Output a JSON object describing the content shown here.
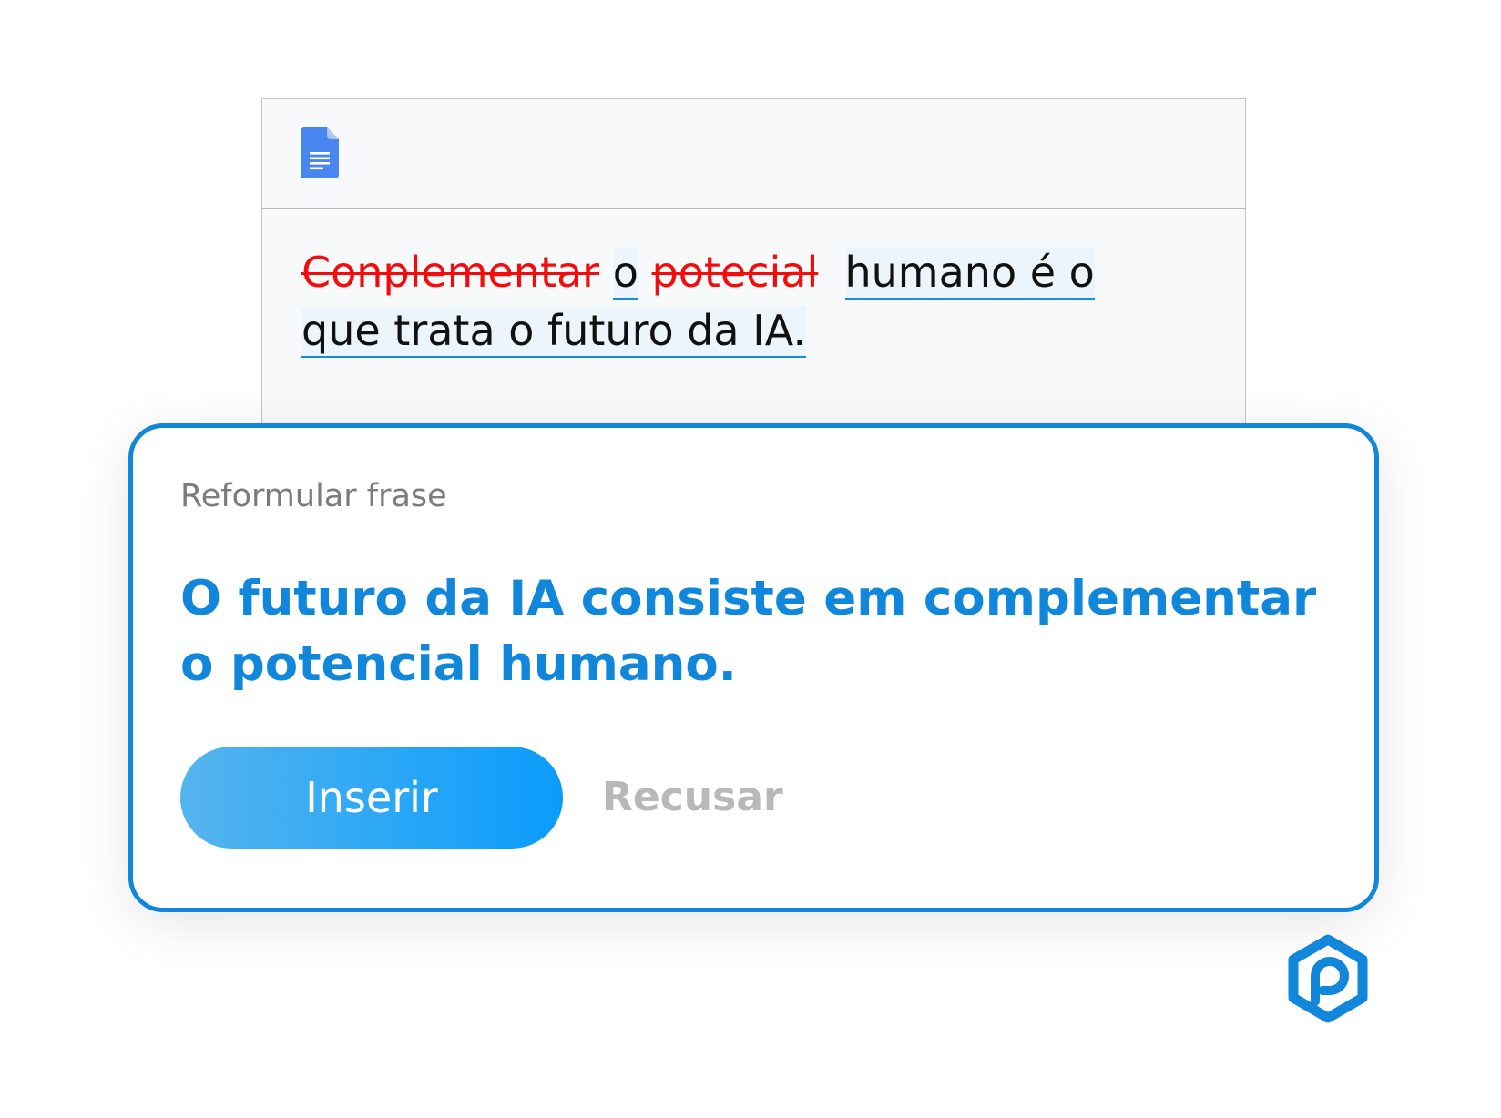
{
  "document": {
    "app_icon": "google-docs-icon",
    "text_parts": {
      "deleted_1": "Conplementar",
      "word_o": "o",
      "deleted_2": "potecial",
      "line1_rest": "humano é o",
      "line2": "que trata o futuro da IA."
    }
  },
  "suggestion_panel": {
    "title": "Reformular frase",
    "suggestion": "O futuro da IA consiste em complementar o potencial humano.",
    "insert_label": "Inserir",
    "decline_label": "Recusar"
  },
  "brand": {
    "logo_icon": "hexagon-p-logo-icon",
    "accent_color": "#1187dc",
    "delete_color": "#f40b0b"
  }
}
